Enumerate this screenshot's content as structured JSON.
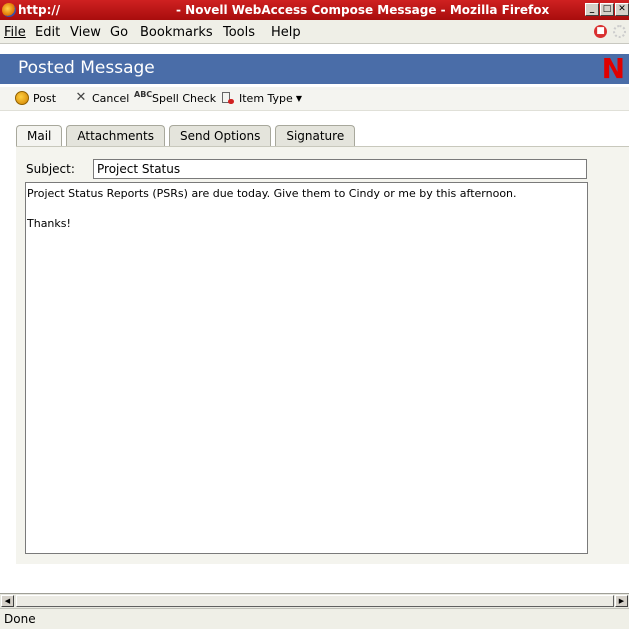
{
  "window": {
    "url": "http://",
    "title": "- Novell WebAccess Compose Message - Mozilla Firefox",
    "buttons": [
      "minimize",
      "maximize",
      "close"
    ]
  },
  "menubar": {
    "items": [
      {
        "label": "File"
      },
      {
        "label": "Edit"
      },
      {
        "label": "View"
      },
      {
        "label": "Go"
      },
      {
        "label": "Bookmarks"
      },
      {
        "label": "Tools"
      },
      {
        "label": "Help"
      }
    ]
  },
  "banner": {
    "title": "Posted Message",
    "logo": "N",
    "bg_color": "#4a6da8",
    "logo_color": "#e00000"
  },
  "toolbar": {
    "post": "Post",
    "cancel": "Cancel",
    "spell_check": "Spell Check",
    "item_type": "Item Type",
    "spell_icon_text": "ABC"
  },
  "tabs": [
    {
      "label": "Mail",
      "active": true
    },
    {
      "label": "Attachments",
      "active": false
    },
    {
      "label": "Send Options",
      "active": false
    },
    {
      "label": "Signature",
      "active": false
    }
  ],
  "compose": {
    "subject_label": "Subject:",
    "subject_value": "Project Status",
    "body_line1": "Project Status Reports (PSRs) are due today.  Give them to Cindy or me by this afternoon.",
    "body_line2": "Thanks!"
  },
  "status": {
    "text": "Done"
  },
  "icons": {
    "browser": "firefox-icon",
    "stop": "stop-icon",
    "throbber": "throbber-icon",
    "post": "post-icon",
    "cancel": "cancel-icon",
    "spell": "spell-check-icon",
    "item_type": "item-type-icon"
  }
}
